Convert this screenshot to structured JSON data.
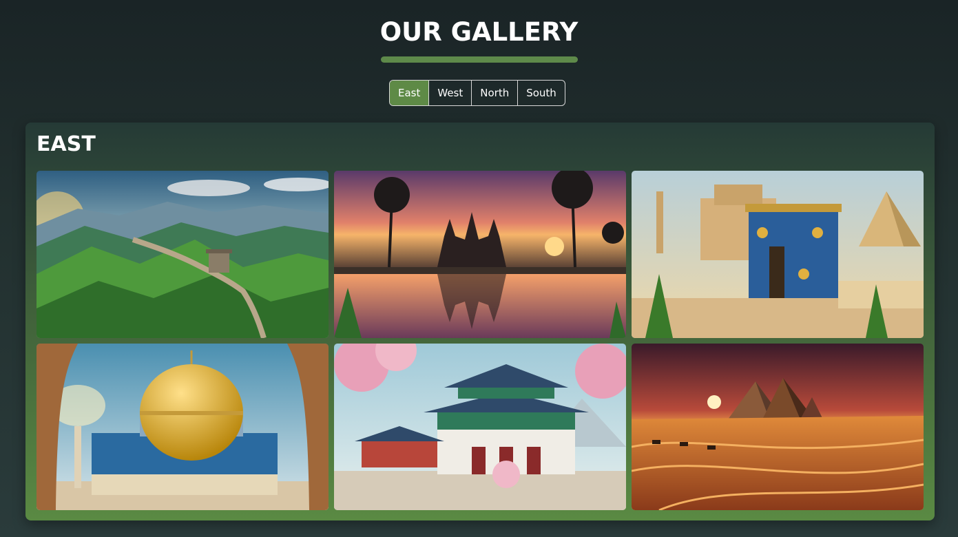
{
  "header": {
    "title": "OUR GALLERY"
  },
  "tabs": [
    {
      "label": "East",
      "active": true
    },
    {
      "label": "West",
      "active": false
    },
    {
      "label": "North",
      "active": false
    },
    {
      "label": "South",
      "active": false
    }
  ],
  "section": {
    "title": "EAST"
  },
  "colors": {
    "accent": "#5e8a46",
    "underline": "#5e8a4a",
    "background": "#1e2a2b"
  }
}
